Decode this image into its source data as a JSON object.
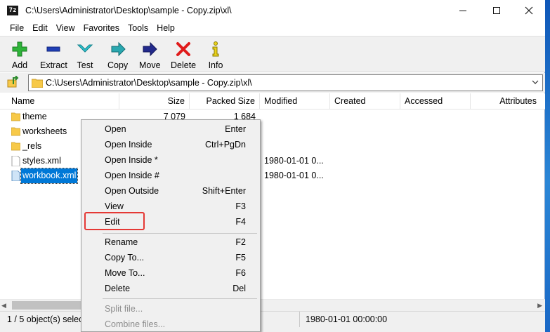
{
  "window": {
    "title": "C:\\Users\\Administrator\\Desktop\\sample -  Copy.zip\\xl\\",
    "app_icon_text": "7z"
  },
  "menubar": [
    "File",
    "Edit",
    "View",
    "Favorites",
    "Tools",
    "Help"
  ],
  "toolbar": [
    {
      "label": "Add",
      "icon": "add-icon"
    },
    {
      "label": "Extract",
      "icon": "extract-icon"
    },
    {
      "label": "Test",
      "icon": "test-icon"
    },
    {
      "label": "Copy",
      "icon": "copy-icon"
    },
    {
      "label": "Move",
      "icon": "move-icon"
    },
    {
      "label": "Delete",
      "icon": "delete-icon"
    },
    {
      "label": "Info",
      "icon": "info-icon"
    }
  ],
  "address": {
    "path": "C:\\Users\\Administrator\\Desktop\\sample -  Copy.zip\\xl\\"
  },
  "columns": [
    "Name",
    "Size",
    "Packed Size",
    "Modified",
    "Created",
    "Accessed",
    "Attributes"
  ],
  "files": [
    {
      "name": "theme",
      "type": "folder",
      "size": "7 079",
      "packed": "1 684",
      "modified": ""
    },
    {
      "name": "worksheets",
      "type": "folder",
      "size": "",
      "packed": "",
      "modified": ""
    },
    {
      "name": "_rels",
      "type": "folder",
      "size": "",
      "packed": "",
      "modified": ""
    },
    {
      "name": "styles.xml",
      "type": "file",
      "size": "",
      "packed": "",
      "modified": "1980-01-01 0..."
    },
    {
      "name": "workbook.xml",
      "type": "file",
      "size": "",
      "packed": "",
      "modified": "1980-01-01 0..."
    }
  ],
  "selected_index": 4,
  "context_menu": {
    "groups": [
      [
        {
          "label": "Open",
          "shortcut": "Enter",
          "disabled": false
        },
        {
          "label": "Open Inside",
          "shortcut": "Ctrl+PgDn",
          "disabled": false
        },
        {
          "label": "Open Inside *",
          "shortcut": "",
          "disabled": false
        },
        {
          "label": "Open Inside #",
          "shortcut": "",
          "disabled": false
        },
        {
          "label": "Open Outside",
          "shortcut": "Shift+Enter",
          "disabled": false
        },
        {
          "label": "View",
          "shortcut": "F3",
          "disabled": false
        },
        {
          "label": "Edit",
          "shortcut": "F4",
          "disabled": false
        }
      ],
      [
        {
          "label": "Rename",
          "shortcut": "F2",
          "disabled": false
        },
        {
          "label": "Copy To...",
          "shortcut": "F5",
          "disabled": false
        },
        {
          "label": "Move To...",
          "shortcut": "F6",
          "disabled": false
        },
        {
          "label": "Delete",
          "shortcut": "Del",
          "disabled": false
        }
      ],
      [
        {
          "label": "Split file...",
          "shortcut": "",
          "disabled": true
        },
        {
          "label": "Combine files...",
          "shortcut": "",
          "disabled": true
        }
      ]
    ],
    "highlighted_label": "Edit"
  },
  "status": {
    "selection": "1 / 5 object(s) selected",
    "modified": "1980-01-01 00:00:00"
  },
  "colors": {
    "selection": "#0078d7",
    "highlight_box": "#e53935",
    "folder": "#f7c948"
  }
}
